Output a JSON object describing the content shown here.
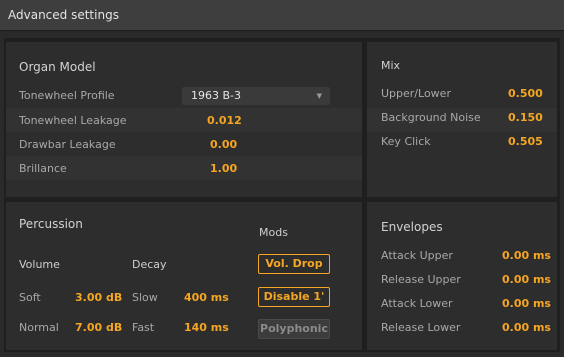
{
  "window": {
    "title": "Advanced settings"
  },
  "organ_model": {
    "title": "Organ Model",
    "tonewheel_profile": {
      "label": "Tonewheel Profile",
      "value": "1963 B-3"
    },
    "tonewheel_leakage": {
      "label": "Tonewheel Leakage",
      "value": "0.012"
    },
    "drawbar_leakage": {
      "label": "Drawbar Leakage",
      "value": "0.00"
    },
    "brillance": {
      "label": "Brillance",
      "value": "1.00"
    }
  },
  "mix": {
    "title": "Mix",
    "upper_lower": {
      "label": "Upper/Lower",
      "value": "0.500"
    },
    "background_noise": {
      "label": "Background Noise",
      "value": "0.150"
    },
    "key_click": {
      "label": "Key Click",
      "value": "0.505"
    }
  },
  "percussion": {
    "title": "Percussion",
    "volume_header": "Volume",
    "decay_header": "Decay",
    "mods_header": "Mods",
    "soft": {
      "label": "Soft",
      "value": "3.00 dB"
    },
    "normal": {
      "label": "Normal",
      "value": "7.00 dB"
    },
    "slow": {
      "label": "Slow",
      "value": "400 ms"
    },
    "fast": {
      "label": "Fast",
      "value": "140 ms"
    },
    "mods": {
      "vol_drop": {
        "label": "Vol. Drop",
        "active": true
      },
      "disable_1": {
        "label": "Disable 1'",
        "active": true
      },
      "polyphonic": {
        "label": "Polyphonic",
        "active": false
      }
    }
  },
  "envelopes": {
    "title": "Envelopes",
    "attack_upper": {
      "label": "Attack Upper",
      "value": "0.00 ms"
    },
    "release_upper": {
      "label": "Release Upper",
      "value": "0.00 ms"
    },
    "attack_lower": {
      "label": "Attack Lower",
      "value": "0.00 ms"
    },
    "release_lower": {
      "label": "Release Lower",
      "value": "0.00 ms"
    }
  },
  "colors": {
    "accent": "#f5a623",
    "panel": "#2d2d2d",
    "background": "#1f1f1f"
  }
}
